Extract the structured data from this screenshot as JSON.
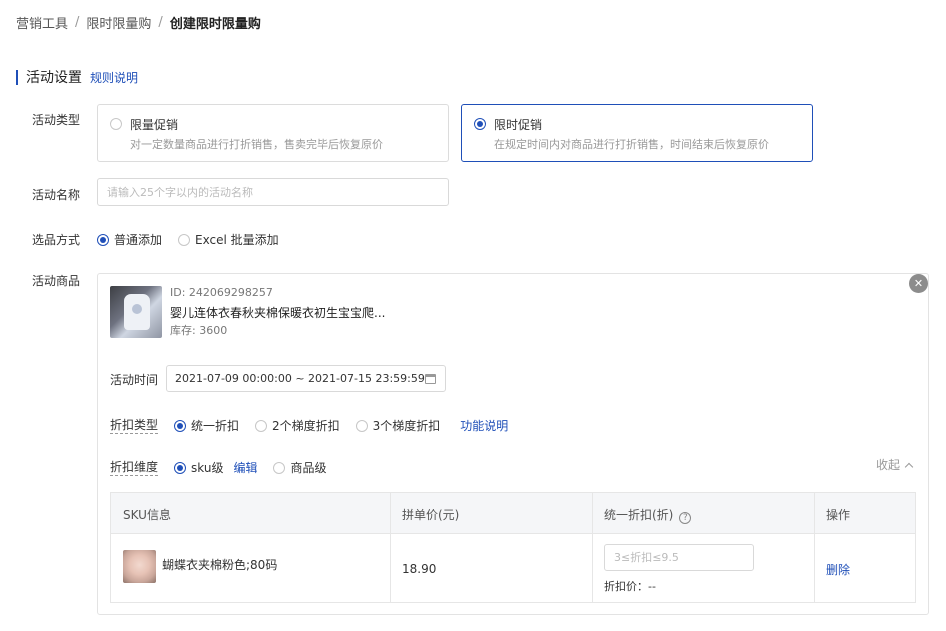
{
  "breadcrumb": {
    "item1": "营销工具",
    "item2": "限时限量购",
    "current": "创建限时限量购",
    "sep": "/"
  },
  "section": {
    "title": "活动设置",
    "link": "规则说明"
  },
  "labels": {
    "type": "活动类型",
    "name": "活动名称",
    "select_method": "选品方式",
    "products": "活动商品"
  },
  "activity_types": [
    {
      "title": "限量促销",
      "desc": "对一定数量商品进行打折销售，售卖完毕后恢复原价",
      "selected": false
    },
    {
      "title": "限时促销",
      "desc": "在规定时间内对商品进行打折销售，时间结束后恢复原价",
      "selected": true
    }
  ],
  "name_input": {
    "placeholder": "请输入25个字以内的活动名称",
    "value": ""
  },
  "select_method": {
    "opt1": "普通添加",
    "opt2": "Excel 批量添加",
    "selected": "普通添加"
  },
  "product": {
    "id": "ID: 242069298257",
    "name": "婴儿连体衣春秋夹棉保暖衣初生宝宝爬...",
    "stock": "库存: 3600",
    "time_label": "活动时间",
    "time_value": "2021-07-09 00:00:00 ~ 2021-07-15 23:59:59",
    "discount_type_label": "折扣类型",
    "discount_types": [
      "统一折扣",
      "2个梯度折扣",
      "3个梯度折扣"
    ],
    "discount_type_selected": "统一折扣",
    "discount_help_link": "功能说明",
    "dimension_label": "折扣维度",
    "dimension_opt1": "sku级",
    "dimension_edit": "编辑",
    "dimension_opt2": "商品级",
    "dimension_selected": "sku级",
    "collapse_label": "收起",
    "close_glyph": "✕"
  },
  "sku_table": {
    "headers": {
      "info": "SKU信息",
      "price": "拼单价(元)",
      "discount": "统一折扣(折)",
      "action": "操作"
    },
    "help_glyph": "?",
    "rows": [
      {
        "name": "蝴蝶衣夹棉粉色;80码",
        "price": "18.90",
        "discount_placeholder": "3≤折扣≤9.5",
        "discount_price": "折扣价：--",
        "action": "删除"
      }
    ]
  },
  "colors": {
    "accent": "#1f4fb8",
    "border": "#dcdcdc",
    "muted": "#999999"
  }
}
